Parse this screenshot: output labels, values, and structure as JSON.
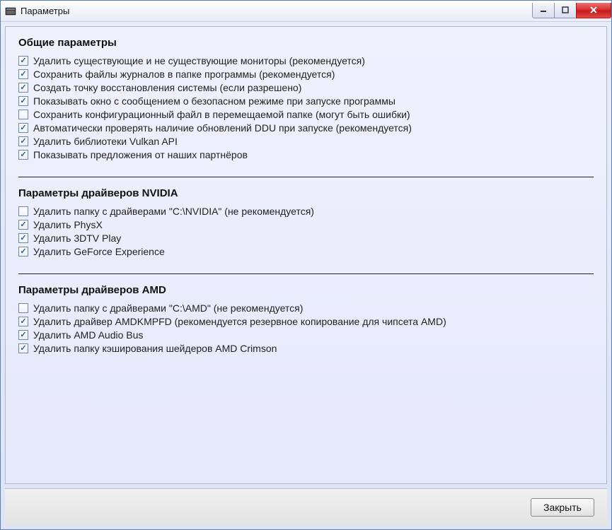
{
  "window": {
    "title": "Параметры"
  },
  "sections": {
    "general": {
      "title": "Общие параметры",
      "items": [
        {
          "label": "Удалить существующие и не существующие мониторы (рекомендуется)",
          "checked": true
        },
        {
          "label": "Сохранить файлы журналов в папке программы (рекомендуется)",
          "checked": true
        },
        {
          "label": "Создать точку восстановления системы (если разрешено)",
          "checked": true
        },
        {
          "label": "Показывать окно с сообщением о безопасном режиме при запуске программы",
          "checked": true
        },
        {
          "label": "Сохранить конфигурационный файл в перемещаемой папке (могут быть ошибки)",
          "checked": false
        },
        {
          "label": "Автоматически проверять наличие обновлений DDU при запуске (рекомендуется)",
          "checked": true
        },
        {
          "label": "Удалить библиотеки Vulkan API",
          "checked": true
        },
        {
          "label": "Показывать предложения от наших партнёров",
          "checked": true
        }
      ]
    },
    "nvidia": {
      "title": "Параметры драйверов NVIDIA",
      "items": [
        {
          "label": "Удалить папку с драйверами \"C:\\NVIDIA\" (не рекомендуется)",
          "checked": false
        },
        {
          "label": "Удалить PhysX",
          "checked": true
        },
        {
          "label": "Удалить 3DTV Play",
          "checked": true
        },
        {
          "label": "Удалить GeForce Experience",
          "checked": true
        }
      ]
    },
    "amd": {
      "title": "Параметры драйверов AMD",
      "items": [
        {
          "label": "Удалить папку с драйверами \"C:\\AMD\" (не рекомендуется)",
          "checked": false
        },
        {
          "label": "Удалить драйвер AMDKMPFD (рекомендуется резервное копирование для чипсета AMD)",
          "checked": true
        },
        {
          "label": "Удалить AMD Audio Bus",
          "checked": true
        },
        {
          "label": "Удалить папку кэширования шейдеров AMD Crimson",
          "checked": true
        }
      ]
    }
  },
  "buttons": {
    "close": "Закрыть"
  }
}
